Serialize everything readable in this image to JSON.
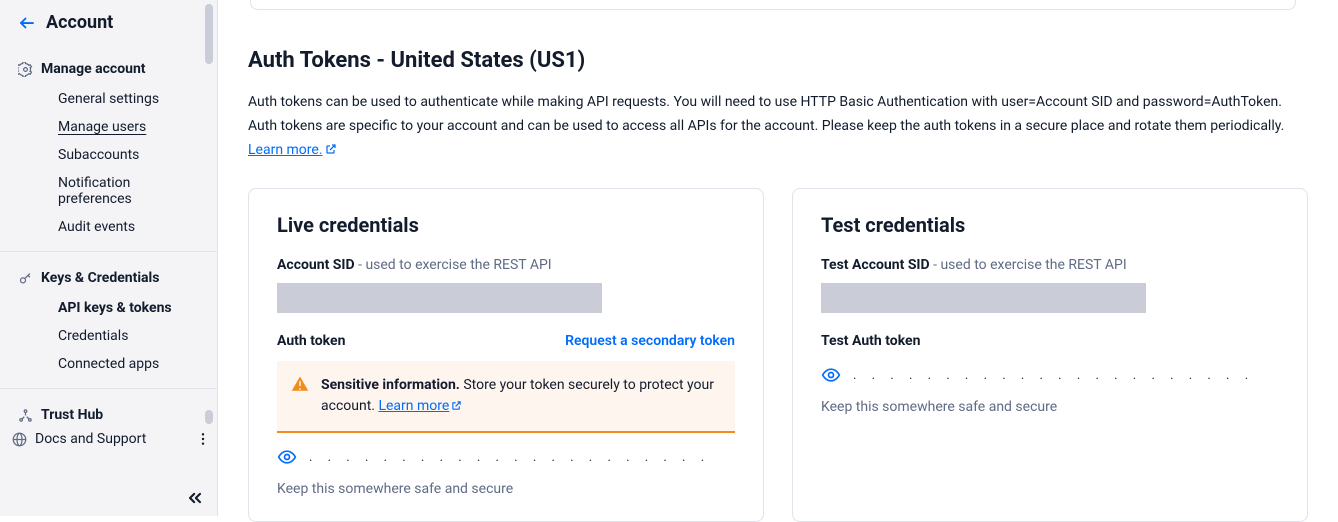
{
  "sidebar": {
    "back_label": "Account",
    "manage_account": {
      "title": "Manage account",
      "items": [
        "General settings",
        "Manage users",
        "Subaccounts",
        "Notification preferences",
        "Audit events"
      ]
    },
    "keys": {
      "title": "Keys & Credentials",
      "items": [
        "API keys & tokens",
        "Credentials",
        "Connected apps"
      ]
    },
    "trust_hub": "Trust Hub",
    "docs_support": "Docs and Support"
  },
  "page": {
    "title": "Auth Tokens - United States (US1)",
    "description": "Auth tokens can be used to authenticate while making API requests. You will need to use HTTP Basic Authentication with user=Account SID and password=AuthToken. Auth tokens are specific to your account and can be used to access all APIs for the account. Please keep the auth tokens in a secure place and rotate them periodically. ",
    "learn_more": "Learn more."
  },
  "live": {
    "title": "Live credentials",
    "sid_label": "Account SID",
    "sid_hint": " - used to exercise the REST API",
    "auth_token_label": "Auth token",
    "request_secondary": "Request a secondary token",
    "alert_strong": "Sensitive information.",
    "alert_body": " Store your token securely to protect your account. ",
    "alert_link": "Learn more",
    "token_mask": ". . . . . . . . . . . . . . . . . . . . . .",
    "hint": "Keep this somewhere safe and secure"
  },
  "test": {
    "title": "Test credentials",
    "sid_label": "Test Account SID",
    "sid_hint": " - used to exercise the REST API",
    "auth_token_label": "Test Auth token",
    "token_mask": ". . . . . . . . . . . . . . . . . . . . . .",
    "hint": "Keep this somewhere safe and secure"
  }
}
